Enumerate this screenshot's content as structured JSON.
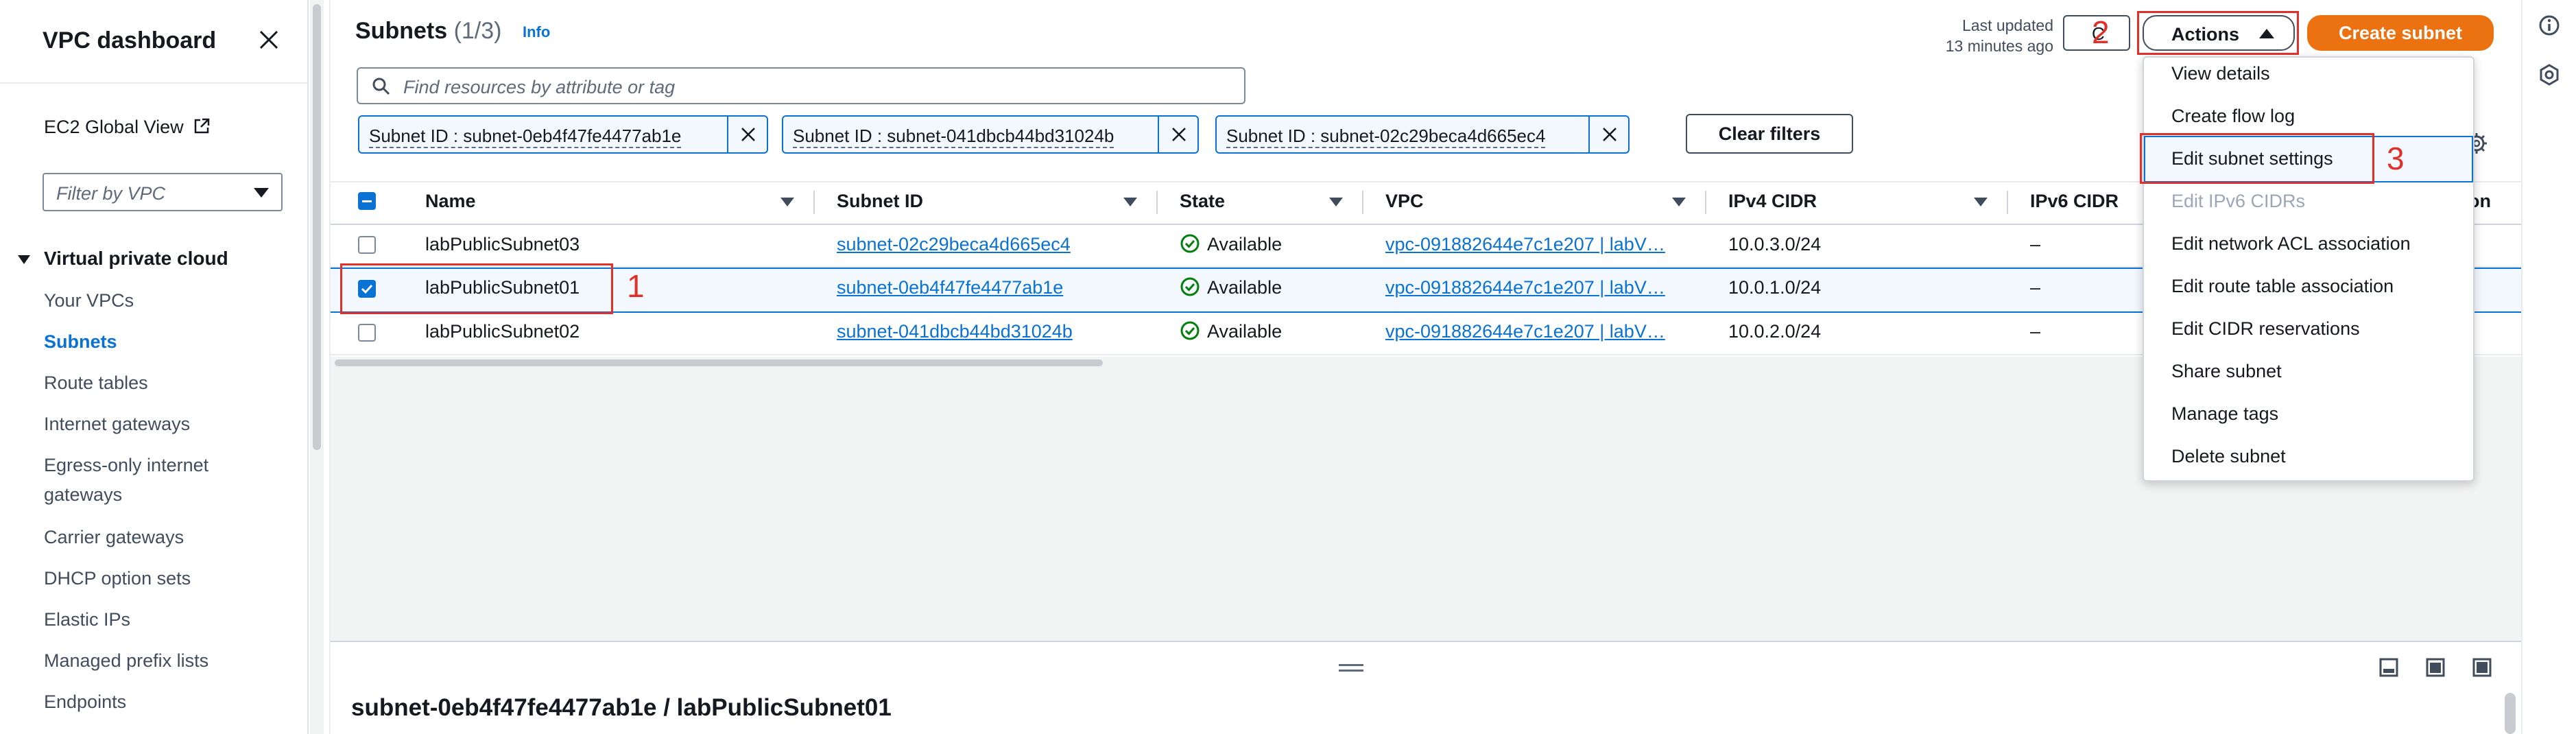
{
  "sidebar": {
    "title": "VPC dashboard",
    "ec2_link": "EC2 Global View",
    "filter_placeholder": "Filter by VPC",
    "section": "Virtual private cloud",
    "items": [
      {
        "label": "Your VPCs"
      },
      {
        "label": "Subnets"
      },
      {
        "label": "Route tables"
      },
      {
        "label": "Internet gateways"
      },
      {
        "label": "Egress-only internet"
      },
      {
        "label": "gateways"
      },
      {
        "label": "Carrier gateways"
      },
      {
        "label": "DHCP option sets"
      },
      {
        "label": "Elastic IPs"
      },
      {
        "label": "Managed prefix lists"
      },
      {
        "label": "Endpoints"
      }
    ]
  },
  "header": {
    "title": "Subnets",
    "count": "(1/3)",
    "info": "Info",
    "last_updated_line1": "Last updated",
    "last_updated_line2": "13 minutes ago",
    "refresh_glyph": "C",
    "actions": "Actions",
    "create": "Create subnet"
  },
  "search": {
    "placeholder": "Find resources by attribute or tag"
  },
  "filters": [
    {
      "label": "Subnet ID : subnet-0eb4f47fe4477ab1e"
    },
    {
      "label": "Subnet ID : subnet-041dbcb44bd31024b"
    },
    {
      "label": "Subnet ID : subnet-02c29beca4d665ec4"
    }
  ],
  "clear_filters": "Clear filters",
  "table": {
    "columns": [
      "Name",
      "Subnet ID",
      "State",
      "VPC",
      "IPv4 CIDR",
      "IPv6 CIDR",
      "iation"
    ],
    "rows": [
      {
        "name": "labPublicSubnet03",
        "subnet_id": "subnet-02c29beca4d665ec4",
        "state": "Available",
        "vpc": "vpc-091882644e7c1e207 | labV…",
        "ipv4": "10.0.3.0/24",
        "ipv6": "–",
        "selected": false
      },
      {
        "name": "labPublicSubnet01",
        "subnet_id": "subnet-0eb4f47fe4477ab1e",
        "state": "Available",
        "vpc": "vpc-091882644e7c1e207 | labV…",
        "ipv4": "10.0.1.0/24",
        "ipv6": "–",
        "selected": true
      },
      {
        "name": "labPublicSubnet02",
        "subnet_id": "subnet-041dbcb44bd31024b",
        "state": "Available",
        "vpc": "vpc-091882644e7c1e207 | labV…",
        "ipv4": "10.0.2.0/24",
        "ipv6": "–",
        "selected": false
      }
    ]
  },
  "actions_menu": {
    "items": [
      {
        "label": "View details",
        "disabled": false
      },
      {
        "label": "Create flow log",
        "disabled": false
      },
      {
        "label": "Edit subnet settings",
        "disabled": false
      },
      {
        "label": "Edit IPv6 CIDRs",
        "disabled": true
      },
      {
        "label": "Edit network ACL association",
        "disabled": false
      },
      {
        "label": "Edit route table association",
        "disabled": false
      },
      {
        "label": "Edit CIDR reservations",
        "disabled": false
      },
      {
        "label": "Share subnet",
        "disabled": false
      },
      {
        "label": "Manage tags",
        "disabled": false
      },
      {
        "label": "Delete subnet",
        "disabled": false
      }
    ]
  },
  "detail_panel": {
    "title": "subnet-0eb4f47fe4477ab1e / labPublicSubnet01"
  },
  "annotations": [
    "1",
    "2",
    "3"
  ],
  "colors": {
    "primary": "#0972d3",
    "orange": "#ec7211",
    "success": "#037f0c",
    "annotation": "#e0302a"
  }
}
